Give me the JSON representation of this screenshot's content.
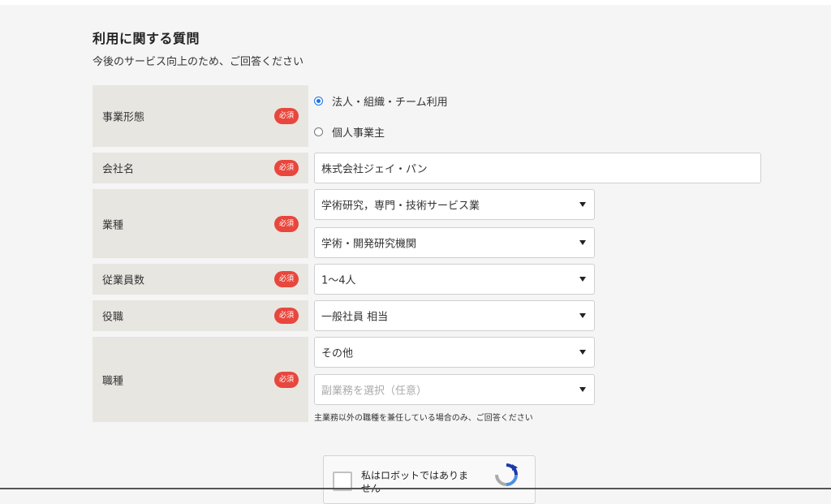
{
  "section": {
    "title": "利用に関する質問",
    "subtitle": "今後のサービス向上のため、ご回答ください"
  },
  "required_label": "必須",
  "business_type": {
    "label": "事業形態",
    "options": [
      {
        "label": "法人・組織・チーム利用",
        "checked": true
      },
      {
        "label": "個人事業主",
        "checked": false
      }
    ]
  },
  "company_name": {
    "label": "会社名",
    "value": "株式会社ジェイ・パン"
  },
  "industry": {
    "label": "業種",
    "primary": "学術研究，専門・技術サービス業",
    "secondary": "学術・開発研究機関"
  },
  "employees": {
    "label": "従業員数",
    "value": "1〜4人"
  },
  "position": {
    "label": "役職",
    "value": "一般社員 相当"
  },
  "job_type": {
    "label": "職種",
    "primary": "その他",
    "secondary_placeholder": "副業務を選択（任意）",
    "hint": "主業務以外の職種を兼任している場合のみ、ご回答ください"
  },
  "captcha": {
    "label": "私はロボットではありません"
  }
}
